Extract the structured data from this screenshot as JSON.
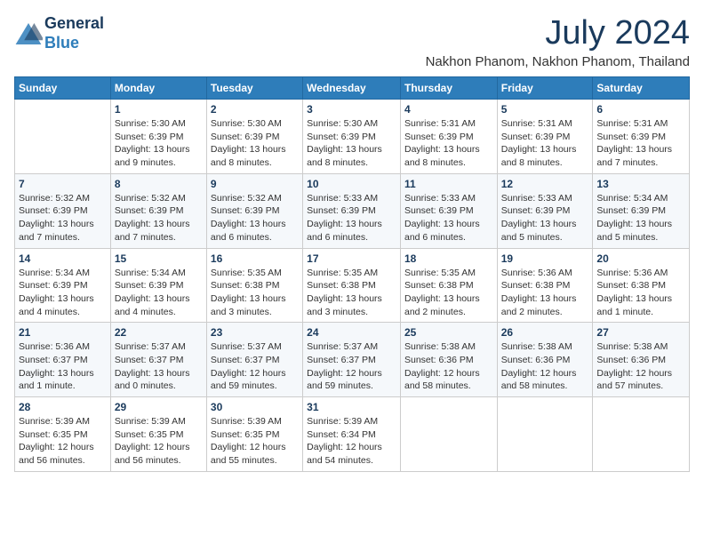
{
  "header": {
    "logo_line1": "General",
    "logo_line2": "Blue",
    "month_title": "July 2024",
    "location": "Nakhon Phanom, Nakhon Phanom, Thailand"
  },
  "days_of_week": [
    "Sunday",
    "Monday",
    "Tuesday",
    "Wednesday",
    "Thursday",
    "Friday",
    "Saturday"
  ],
  "weeks": [
    [
      null,
      {
        "day": 1,
        "sunrise": "5:30 AM",
        "sunset": "6:39 PM",
        "daylight": "13 hours and 9 minutes."
      },
      {
        "day": 2,
        "sunrise": "5:30 AM",
        "sunset": "6:39 PM",
        "daylight": "13 hours and 8 minutes."
      },
      {
        "day": 3,
        "sunrise": "5:30 AM",
        "sunset": "6:39 PM",
        "daylight": "13 hours and 8 minutes."
      },
      {
        "day": 4,
        "sunrise": "5:31 AM",
        "sunset": "6:39 PM",
        "daylight": "13 hours and 8 minutes."
      },
      {
        "day": 5,
        "sunrise": "5:31 AM",
        "sunset": "6:39 PM",
        "daylight": "13 hours and 8 minutes."
      },
      {
        "day": 6,
        "sunrise": "5:31 AM",
        "sunset": "6:39 PM",
        "daylight": "13 hours and 7 minutes."
      }
    ],
    [
      {
        "day": 7,
        "sunrise": "5:32 AM",
        "sunset": "6:39 PM",
        "daylight": "13 hours and 7 minutes."
      },
      {
        "day": 8,
        "sunrise": "5:32 AM",
        "sunset": "6:39 PM",
        "daylight": "13 hours and 7 minutes."
      },
      {
        "day": 9,
        "sunrise": "5:32 AM",
        "sunset": "6:39 PM",
        "daylight": "13 hours and 6 minutes."
      },
      {
        "day": 10,
        "sunrise": "5:33 AM",
        "sunset": "6:39 PM",
        "daylight": "13 hours and 6 minutes."
      },
      {
        "day": 11,
        "sunrise": "5:33 AM",
        "sunset": "6:39 PM",
        "daylight": "13 hours and 6 minutes."
      },
      {
        "day": 12,
        "sunrise": "5:33 AM",
        "sunset": "6:39 PM",
        "daylight": "13 hours and 5 minutes."
      },
      {
        "day": 13,
        "sunrise": "5:34 AM",
        "sunset": "6:39 PM",
        "daylight": "13 hours and 5 minutes."
      }
    ],
    [
      {
        "day": 14,
        "sunrise": "5:34 AM",
        "sunset": "6:39 PM",
        "daylight": "13 hours and 4 minutes."
      },
      {
        "day": 15,
        "sunrise": "5:34 AM",
        "sunset": "6:39 PM",
        "daylight": "13 hours and 4 minutes."
      },
      {
        "day": 16,
        "sunrise": "5:35 AM",
        "sunset": "6:38 PM",
        "daylight": "13 hours and 3 minutes."
      },
      {
        "day": 17,
        "sunrise": "5:35 AM",
        "sunset": "6:38 PM",
        "daylight": "13 hours and 3 minutes."
      },
      {
        "day": 18,
        "sunrise": "5:35 AM",
        "sunset": "6:38 PM",
        "daylight": "13 hours and 2 minutes."
      },
      {
        "day": 19,
        "sunrise": "5:36 AM",
        "sunset": "6:38 PM",
        "daylight": "13 hours and 2 minutes."
      },
      {
        "day": 20,
        "sunrise": "5:36 AM",
        "sunset": "6:38 PM",
        "daylight": "13 hours and 1 minute."
      }
    ],
    [
      {
        "day": 21,
        "sunrise": "5:36 AM",
        "sunset": "6:37 PM",
        "daylight": "13 hours and 1 minute."
      },
      {
        "day": 22,
        "sunrise": "5:37 AM",
        "sunset": "6:37 PM",
        "daylight": "13 hours and 0 minutes."
      },
      {
        "day": 23,
        "sunrise": "5:37 AM",
        "sunset": "6:37 PM",
        "daylight": "12 hours and 59 minutes."
      },
      {
        "day": 24,
        "sunrise": "5:37 AM",
        "sunset": "6:37 PM",
        "daylight": "12 hours and 59 minutes."
      },
      {
        "day": 25,
        "sunrise": "5:38 AM",
        "sunset": "6:36 PM",
        "daylight": "12 hours and 58 minutes."
      },
      {
        "day": 26,
        "sunrise": "5:38 AM",
        "sunset": "6:36 PM",
        "daylight": "12 hours and 58 minutes."
      },
      {
        "day": 27,
        "sunrise": "5:38 AM",
        "sunset": "6:36 PM",
        "daylight": "12 hours and 57 minutes."
      }
    ],
    [
      {
        "day": 28,
        "sunrise": "5:39 AM",
        "sunset": "6:35 PM",
        "daylight": "12 hours and 56 minutes."
      },
      {
        "day": 29,
        "sunrise": "5:39 AM",
        "sunset": "6:35 PM",
        "daylight": "12 hours and 56 minutes."
      },
      {
        "day": 30,
        "sunrise": "5:39 AM",
        "sunset": "6:35 PM",
        "daylight": "12 hours and 55 minutes."
      },
      {
        "day": 31,
        "sunrise": "5:39 AM",
        "sunset": "6:34 PM",
        "daylight": "12 hours and 54 minutes."
      },
      null,
      null,
      null
    ]
  ],
  "labels": {
    "sunrise": "Sunrise:",
    "sunset": "Sunset:",
    "daylight": "Daylight:"
  }
}
